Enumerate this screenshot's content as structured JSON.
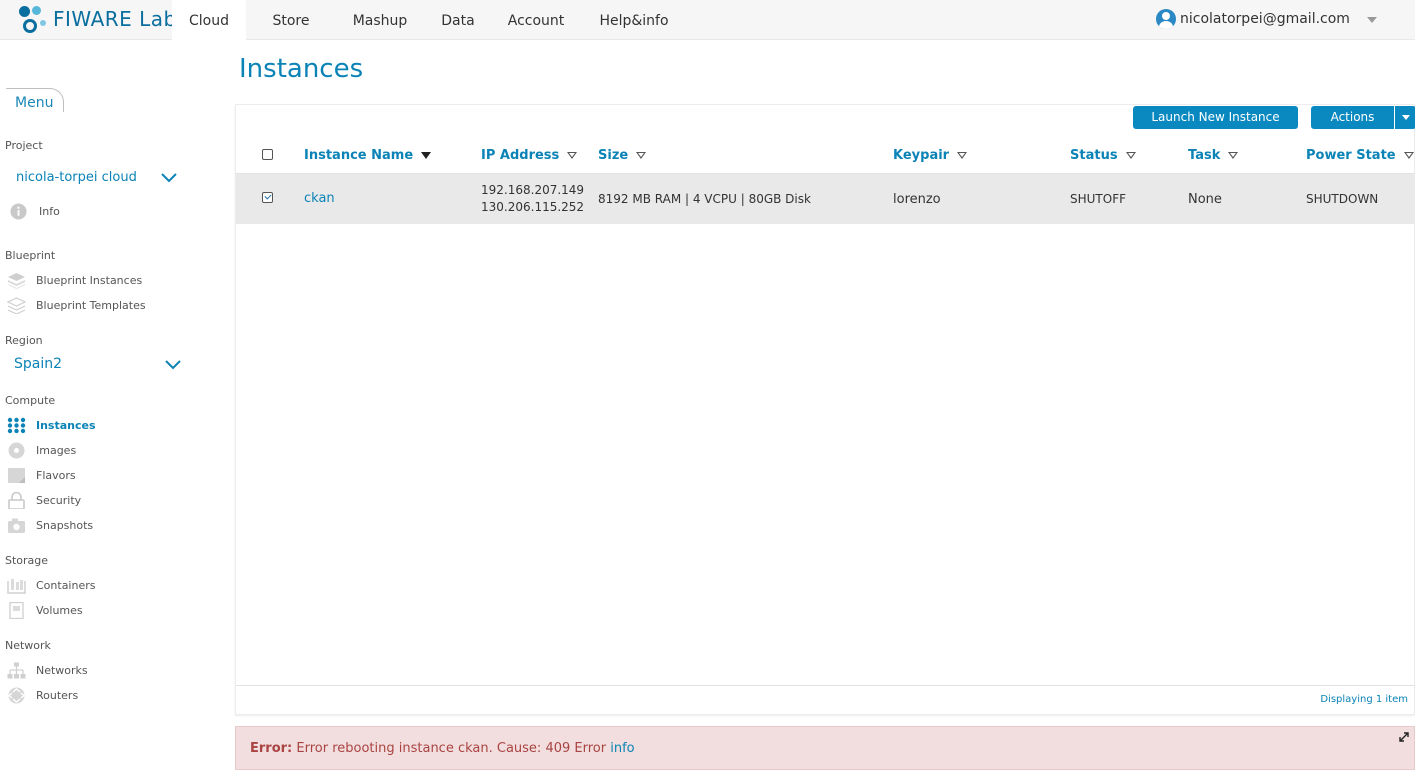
{
  "brand": {
    "logo_text": "FIWARE Lab"
  },
  "nav": {
    "items": [
      {
        "label": "Cloud",
        "active": true
      },
      {
        "label": "Store"
      },
      {
        "label": "Mashup"
      },
      {
        "label": "Data"
      },
      {
        "label": "Account"
      },
      {
        "label": "Help&info"
      }
    ]
  },
  "user": {
    "email": "nicolatorpei@gmail.com"
  },
  "sidebar": {
    "menu_label": "Menu",
    "project_label": "Project",
    "project_value": "nicola-torpei cloud",
    "info_label": "Info",
    "blueprint_label": "Blueprint",
    "blueprint_items": [
      "Blueprint Instances",
      "Blueprint Templates"
    ],
    "region_label": "Region",
    "region_value": "Spain2",
    "compute_label": "Compute",
    "compute_items": [
      "Instances",
      "Images",
      "Flavors",
      "Security",
      "Snapshots"
    ],
    "storage_label": "Storage",
    "storage_items": [
      "Containers",
      "Volumes"
    ],
    "network_label": "Network",
    "network_items": [
      "Networks",
      "Routers"
    ]
  },
  "main": {
    "title": "Instances",
    "launch_button": "Launch New Instance",
    "actions_button": "Actions",
    "columns": [
      "Instance Name",
      "IP Address",
      "Size",
      "Keypair",
      "Status",
      "Task",
      "Power State"
    ],
    "rows": [
      {
        "name": "ckan",
        "ip1": "192.168.207.149",
        "ip2": "130.206.115.252",
        "size": "8192 MB RAM | 4 VCPU | 80GB Disk",
        "keypair": "lorenzo",
        "status": "SHUTOFF",
        "task": "None",
        "power_state": "SHUTDOWN",
        "selected": true
      }
    ],
    "footer_count": "Displaying 1 item"
  },
  "error": {
    "prefix": "Error:",
    "message": "Error rebooting instance ckan. Cause: 409 Error",
    "link": "info"
  },
  "colors": {
    "accent": "#0b83b6",
    "button": "#0a89c1",
    "error_bg": "#f2dede",
    "error_text": "#a94442"
  }
}
